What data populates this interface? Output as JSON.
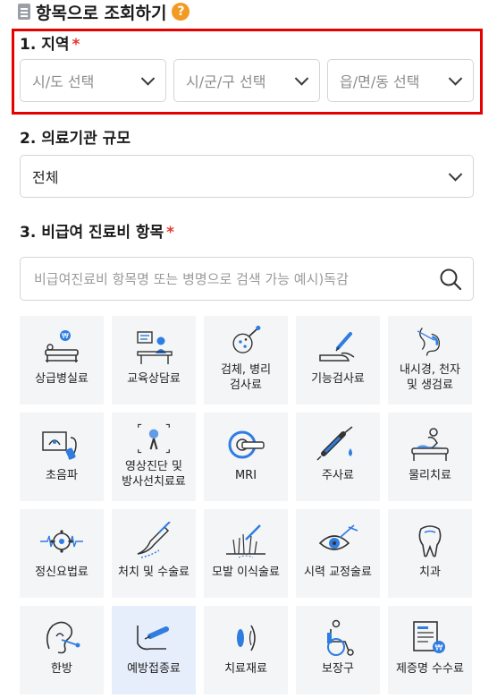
{
  "header": {
    "title": "항목으로 조회하기",
    "help": "?"
  },
  "region": {
    "label": "1. 지역",
    "required": "*",
    "selects": [
      {
        "placeholder": "시/도 선택"
      },
      {
        "placeholder": "시/군/구 선택"
      },
      {
        "placeholder": "읍/면/동 선택"
      }
    ]
  },
  "institution": {
    "label": "2. 의료기관 규모",
    "value": "전체"
  },
  "items": {
    "label": "3. 비급여 진료비 항목",
    "required": "*",
    "search_placeholder": "비급여진료비 항목명 또는 병명으로 검색 가능 예시)독감"
  },
  "categories": [
    {
      "label": "상급병실료",
      "icon": "hospital-bed-icon"
    },
    {
      "label": "교육상담료",
      "icon": "counseling-icon"
    },
    {
      "label": "검체, 병리\n검사료",
      "icon": "specimen-icon"
    },
    {
      "label": "기능검사료",
      "icon": "function-test-icon"
    },
    {
      "label": "내시경, 천자\n및 생검료",
      "icon": "endoscope-icon"
    },
    {
      "label": "초음파",
      "icon": "ultrasound-icon"
    },
    {
      "label": "영상진단 및\n방사선치료료",
      "icon": "xray-icon"
    },
    {
      "label": "MRI",
      "icon": "mri-icon"
    },
    {
      "label": "주사료",
      "icon": "syringe-icon"
    },
    {
      "label": "물리치료",
      "icon": "physio-icon"
    },
    {
      "label": "정신요법료",
      "icon": "brain-wave-icon"
    },
    {
      "label": "처치 및 수술료",
      "icon": "surgery-icon"
    },
    {
      "label": "모발 이식술료",
      "icon": "hair-transplant-icon"
    },
    {
      "label": "시력 교정술료",
      "icon": "eye-laser-icon"
    },
    {
      "label": "치과",
      "icon": "tooth-icon"
    },
    {
      "label": "한방",
      "icon": "acupuncture-ear-icon"
    },
    {
      "label": "예방접종료",
      "icon": "vaccination-icon",
      "selected": true
    },
    {
      "label": "치료재료",
      "icon": "lens-material-icon"
    },
    {
      "label": "보장구",
      "icon": "wheelchair-icon"
    },
    {
      "label": "제증명 수수료",
      "icon": "certificate-icon"
    }
  ]
}
